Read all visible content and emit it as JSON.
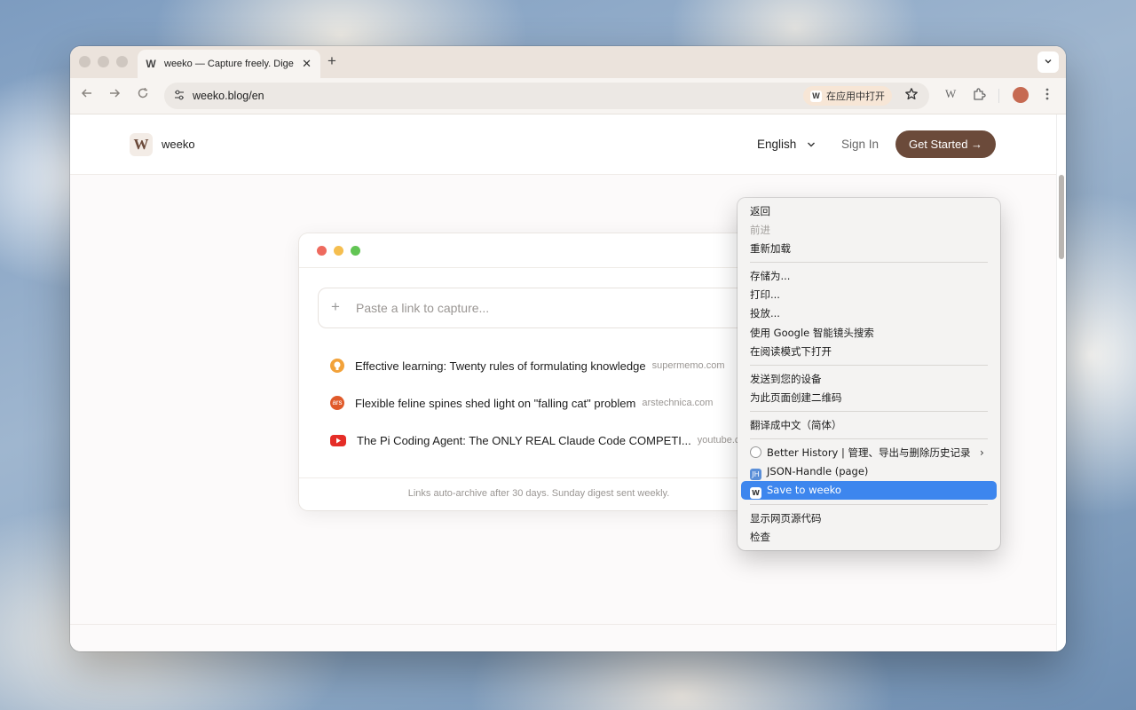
{
  "browser": {
    "tab": {
      "favicon": "W",
      "title": "weeko — Capture freely. Dige",
      "close": "✕"
    },
    "new_tab": "+",
    "tab_dropdown": "⌄",
    "url": "weeko.blog/en",
    "open_in_app": {
      "icon": "W",
      "label": "在应用中打开"
    },
    "icons": {
      "back": "back-arrow-icon",
      "forward": "forward-arrow-icon",
      "reload": "reload-icon",
      "site_info": "tune-icon",
      "bookmark": "star-icon",
      "weeko_ext": "weeko-extension-icon",
      "extensions": "puzzle-icon",
      "menu": "kebab-menu-icon"
    }
  },
  "site": {
    "logo_mark": "W",
    "logo_text": "weeko",
    "language": "English",
    "sign_in": "Sign In",
    "cta": "Get Started →"
  },
  "card": {
    "paste_placeholder": "Paste a link to capture...",
    "links": [
      {
        "title": "Effective learning: Twenty rules of formulating knowledge",
        "domain": "supermemo.com",
        "icon": "lightbulb-icon",
        "color": "#f2a23a"
      },
      {
        "title": "Flexible feline spines shed light on \"falling cat\" problem",
        "domain": "arstechnica.com",
        "icon": "ars-icon",
        "color": "#e05a2a",
        "icon_text": "ars"
      },
      {
        "title": "The Pi Coding Agent: The ONLY REAL Claude Code COMPETI...",
        "domain": "youtube.c",
        "icon": "youtube-icon",
        "color": "#e52d27"
      }
    ],
    "footer": "Links auto-archive after 30 days. Sunday digest sent weekly."
  },
  "context_menu": {
    "items": [
      {
        "label": "返回"
      },
      {
        "label": "前进",
        "disabled": true
      },
      {
        "label": "重新加载"
      },
      {
        "label": "存储为..."
      },
      {
        "label": "打印..."
      },
      {
        "label": "投放..."
      },
      {
        "label": "使用 Google 智能镜头搜索"
      },
      {
        "label": "在阅读模式下打开"
      },
      {
        "label": "发送到您的设备"
      },
      {
        "label": "为此页面创建二维码"
      },
      {
        "label": "翻译成中文（简体）"
      },
      {
        "label": "Better History | 管理、导出与删除历史记录"
      },
      {
        "label": "JSON-Handle (page)",
        "icon_text": "JH"
      },
      {
        "label": "Save to weeko",
        "icon_text": "W",
        "highlighted": true
      },
      {
        "label": "显示网页源代码"
      },
      {
        "label": "检查"
      }
    ]
  },
  "colors": {
    "brand": "#6b4a3a",
    "highlight": "#3d86ee"
  }
}
